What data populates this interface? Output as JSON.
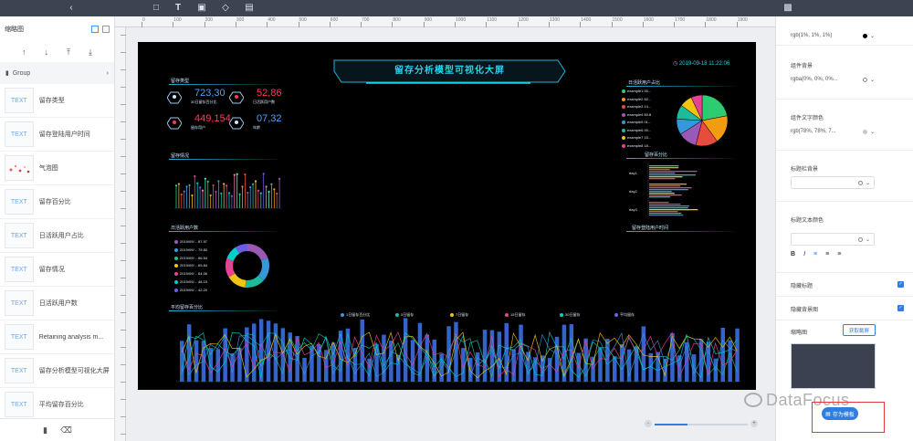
{
  "topbar": {
    "icons": [
      "back-arrow-icon",
      "frame-icon",
      "text-icon",
      "image-icon",
      "shape-icon",
      "layout-icon",
      "preview-icon"
    ]
  },
  "left_panel": {
    "title": "缩略图",
    "group_label": "Group",
    "layers": [
      {
        "thumb": "TEXT",
        "label": "留存类型"
      },
      {
        "thumb": "TEXT",
        "label": "留存登陆用户时间"
      },
      {
        "thumb": "dots",
        "label": "气泡图"
      },
      {
        "thumb": "TEXT",
        "label": "留存百分比"
      },
      {
        "thumb": "TEXT",
        "label": "日活跃用户占比"
      },
      {
        "thumb": "TEXT",
        "label": "留存情况"
      },
      {
        "thumb": "TEXT",
        "label": "日活跃用户数"
      },
      {
        "thumb": "TEXT",
        "label": "Retaining analysis m..."
      },
      {
        "thumb": "TEXT",
        "label": "留存分析模型可视化大屏"
      },
      {
        "thumb": "TEXT",
        "label": "平均留存百分比"
      }
    ]
  },
  "ruler": {
    "ticks": [
      "0",
      "100",
      "200",
      "300",
      "400",
      "500",
      "600",
      "700",
      "800",
      "900",
      "1000",
      "1100",
      "1200",
      "1300",
      "1400",
      "1500",
      "1600",
      "1700",
      "1800",
      "1900"
    ]
  },
  "dashboard": {
    "title": "留存分析模型可视化大屏",
    "timestamp": "2019-09-18 11:22:06",
    "sections": {
      "retention_type": "留存类型",
      "retention_status": "留存情况",
      "daily_active": "日活跃用户数",
      "avg_retention": "平均留存百分比",
      "bubble": "日活跃用户占比",
      "retention_pct": "留存百分比",
      "login_time": "留存登陆用户时间"
    },
    "stats": [
      {
        "value": "723,30",
        "label": "30日留存百分比",
        "color": "#4aa3ff"
      },
      {
        "value": "52,86",
        "label": "日活跃用户数",
        "color": "#ff3b5c"
      },
      {
        "value": "449,154",
        "label": "留存用户",
        "color": "#ff3b5c"
      },
      {
        "value": "07,32",
        "label": "年龄",
        "color": "#4aa3ff"
      }
    ],
    "pie_legend": [
      "example1 00...",
      "example2 62...",
      "example3 14...",
      "example4 60.8",
      "example5 01...",
      "example6 00...",
      "example7 15...",
      "example8 18..."
    ],
    "donut_legend": [
      "2019/09/... 87.97",
      "2019/09/... 79.80",
      "2019/09/... 66.54",
      "2019/09/... 65.84",
      "2019/09/... 64.06",
      "2019/09/... 48.15",
      "2019/09/... 42.20"
    ],
    "hbar_labels": [
      "day1",
      "day2",
      "day3"
    ],
    "avg_legend": [
      "1日留存百分比",
      "3日留存",
      "7日留存",
      "15日留存",
      "30日留存",
      "平均留存"
    ]
  },
  "right_panel": {
    "color_value_1": "rgb(1%, 1%, 1%)",
    "component_bg_label": "组件背景",
    "component_bg_value": "rgba(0%, 0%, 0%...",
    "component_text_color_label": "组件文字颜色",
    "component_text_color_value": "rgb(78%, 78%, 7...",
    "title_bg_label": "标题栏背景",
    "title_text_color_label": "标题文本颜色",
    "format_buttons": [
      "B",
      "I"
    ],
    "hide_title_label": "隐藏标题",
    "hide_bg_label": "隐藏背景图",
    "thumbnail_label": "缩略图",
    "thumbnail_button": "获取截屏",
    "save_template_button": "存为模板"
  },
  "watermark": "DataFocus",
  "colors": {
    "accent": "#2e7de1",
    "topbar": "#3d4451",
    "screen_bg": "#000000",
    "cyan": "#22d3ee",
    "highlight": "#e03a3a"
  }
}
